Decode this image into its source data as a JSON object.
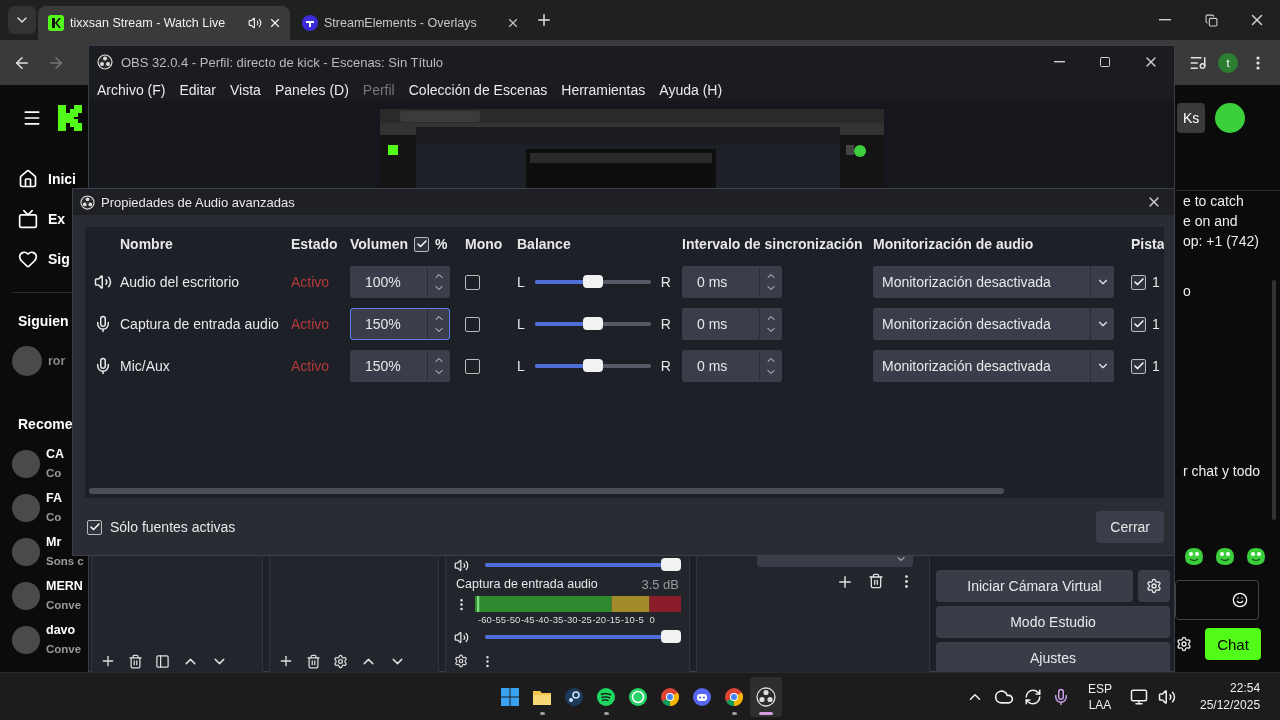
{
  "browser": {
    "tabs": [
      {
        "title": "tixxsan Stream - Watch Live",
        "selected": true,
        "playing_audio": true
      },
      {
        "title": "StreamElements - Overlays",
        "selected": false,
        "playing_audio": false
      }
    ],
    "profile_initial": "t"
  },
  "kick": {
    "nav": [
      {
        "kind": "home",
        "label": "Inici"
      },
      {
        "kind": "browse",
        "label": "Ex"
      },
      {
        "kind": "following",
        "label": "Sig"
      }
    ],
    "following_title": "Siguien",
    "following": [
      {
        "name": "ror"
      }
    ],
    "recommended_title": "Recome",
    "recommended": [
      {
        "name": "CA",
        "subtitle": "Co"
      },
      {
        "name": "FA",
        "subtitle": "Co"
      },
      {
        "name": "Mr",
        "subtitle": "Sons c"
      },
      {
        "name": "MERN",
        "subtitle": "Conve"
      },
      {
        "name": "davo",
        "subtitle": "Conve"
      }
    ],
    "header_button": "Ks",
    "chat_lines": [
      "e to catch",
      "e on and",
      "op: +1 (742)",
      "o",
      "r chat y todo"
    ],
    "chat_button": "Chat"
  },
  "obs": {
    "title": "OBS 32.0.4 - Perfil: directo de kick - Escenas: Sin Título",
    "menu": [
      {
        "label": "Archivo (F)",
        "disabled": false
      },
      {
        "label": "Editar",
        "disabled": false
      },
      {
        "label": "Vista",
        "disabled": false
      },
      {
        "label": "Paneles (D)",
        "disabled": false
      },
      {
        "label": "Perfil",
        "disabled": true
      },
      {
        "label": "Colección de Escenas",
        "disabled": false
      },
      {
        "label": "Herramientas",
        "disabled": false
      },
      {
        "label": "Ayuda (H)",
        "disabled": false
      }
    ],
    "mixer": {
      "upper_channel": {
        "level": 1
      },
      "channel": {
        "name": "Captura de entrada audio",
        "reading": "3.5 dB",
        "level": 1
      },
      "scale": [
        "-60",
        "-55",
        "-50",
        "-45",
        "-40",
        "-35",
        "-30",
        "-25",
        "-20",
        "-15",
        "-10",
        "-5",
        "0"
      ]
    },
    "controls": [
      "Iniciar Cámara Virtual",
      "Modo Estudio",
      "Ajustes"
    ]
  },
  "dialog": {
    "title": "Propiedades de Audio avanzadas",
    "columns": {
      "name": "Nombre",
      "status": "Estado",
      "volume": "Volumen",
      "volume_percent_checked": true,
      "volume_suffix": "%",
      "mono": "Mono",
      "balance": "Balance",
      "sync": "Intervalo de sincronización",
      "monitoring": "Monitorización de audio",
      "tracks": "Pista"
    },
    "rows": [
      {
        "kind": "speaker",
        "name": "Audio del escritorio",
        "status": "Activo",
        "volume": "100%",
        "focused": false,
        "mono": false,
        "balance_left": "L",
        "balance": {
          "level": 0.5
        },
        "balance_right": "R",
        "sync": "0 ms",
        "monitoring": "Monitorización desactivada",
        "track_checked": true,
        "track": "1"
      },
      {
        "kind": "mic",
        "name": "Captura de entrada audio",
        "status": "Activo",
        "volume": "150%",
        "focused": true,
        "mono": false,
        "balance_left": "L",
        "balance": {
          "level": 0.5
        },
        "balance_right": "R",
        "sync": "0 ms",
        "monitoring": "Monitorización desactivada",
        "track_checked": true,
        "track": "1"
      },
      {
        "kind": "mic",
        "name": "Mic/Aux",
        "status": "Activo",
        "volume": "150%",
        "focused": false,
        "mono": false,
        "balance_left": "L",
        "balance": {
          "level": 0.5
        },
        "balance_right": "R",
        "sync": "0 ms",
        "monitoring": "Monitorización desactivada",
        "track_checked": true,
        "track": "1"
      }
    ],
    "active_only_checked": true,
    "active_only_label": "Sólo fuentes activas",
    "close_button": "Cerrar"
  },
  "taskbar": {
    "apps": [
      {
        "kind": "start",
        "running": false,
        "selected": false
      },
      {
        "kind": "files",
        "running": true,
        "selected": false
      },
      {
        "kind": "steam",
        "running": false,
        "selected": false
      },
      {
        "kind": "spotify",
        "running": true,
        "selected": false
      },
      {
        "kind": "whatsapp",
        "running": false,
        "selected": false
      },
      {
        "kind": "chrome",
        "running": false,
        "selected": false
      },
      {
        "kind": "discord",
        "running": false,
        "selected": false
      },
      {
        "kind": "chrome",
        "running": true,
        "selected": false
      },
      {
        "kind": "obs",
        "running": true,
        "selected": true
      }
    ],
    "language": [
      "ESP",
      "LAA"
    ],
    "time": "22:54",
    "date": "25/12/2025"
  }
}
